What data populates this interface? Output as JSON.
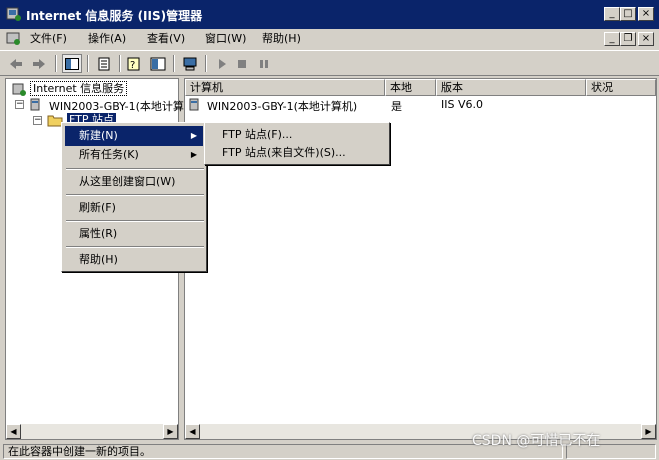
{
  "window": {
    "title": "Internet 信息服务 (IIS)管理器",
    "minimize": "_",
    "maximize": "□",
    "close": "×"
  },
  "menubar": {
    "items": [
      {
        "label": "文件(F)"
      },
      {
        "label": "操作(A)"
      },
      {
        "label": "查看(V)"
      },
      {
        "label": "窗口(W)"
      },
      {
        "label": "帮助(H)"
      }
    ]
  },
  "tree": {
    "root": "Internet 信息服务",
    "server": "WIN2003-GBY-1(本地计算",
    "ftp_sites": "FTP 站点"
  },
  "list": {
    "columns": [
      "计算机",
      "本地",
      "版本",
      "状况"
    ],
    "rows": [
      {
        "computer": "WIN2003-GBY-1(本地计算机)",
        "local": "是",
        "version": "IIS V6.0",
        "status": ""
      }
    ]
  },
  "context_menu": {
    "items": [
      {
        "label": "新建(N)",
        "submenu": true,
        "selected": true
      },
      {
        "label": "所有任务(K)",
        "submenu": true
      },
      {
        "label": "从这里创建窗口(W)"
      },
      {
        "label": "刷新(F)"
      },
      {
        "label": "属性(R)"
      },
      {
        "label": "帮助(H)"
      }
    ]
  },
  "submenu": {
    "items": [
      {
        "label": "FTP 站点(F)..."
      },
      {
        "label": "FTP 站点(来自文件)(S)..."
      }
    ]
  },
  "statusbar": {
    "text": "在此容器中创建一新的项目。"
  },
  "watermark": "CSDN @可惜已不在"
}
